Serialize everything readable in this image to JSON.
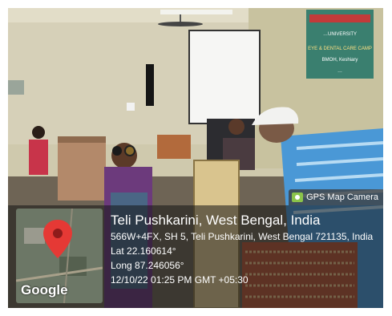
{
  "poster": {
    "lines": [
      "…UNIVERSITY",
      "EYE & DENTAL CARE CAMP",
      "BMOH, Keshiary",
      "…"
    ]
  },
  "camera_app": {
    "badge_text": "GPS Map Camera",
    "badge_icon": "gps-map-camera-icon"
  },
  "geo": {
    "place": "Teli Pushkarini, West Bengal, India",
    "address": "566W+4FX, SH 5, Teli Pushkarini, West Bengal 721135, India",
    "lat": "Lat 22.160614°",
    "long": "Long 87.246056°",
    "datetime": "12/10/22 01:25 PM GMT +05:30"
  },
  "map": {
    "logo": "Google",
    "pin_icon": "map-pin-icon",
    "pin_color": "#e53935"
  },
  "colors": {
    "wall": "#cfc9ad",
    "shirt_stripes": "#4a98d6",
    "saree": "#6c3a7c"
  }
}
